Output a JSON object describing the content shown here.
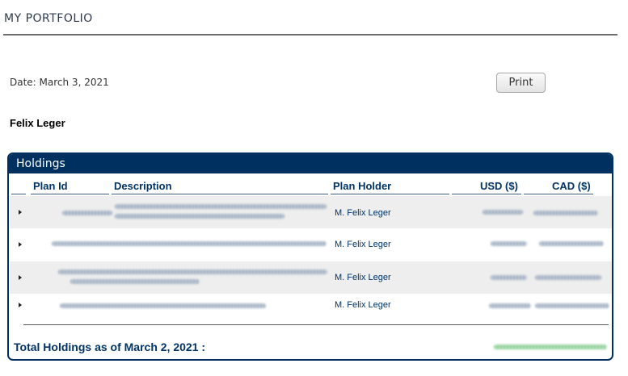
{
  "page": {
    "title": "MY PORTFOLIO"
  },
  "report": {
    "date_line": "Date: March 3, 2021",
    "print_label": "Print",
    "client_name": "Felix Leger"
  },
  "holdings": {
    "panel_title": "Holdings",
    "columns": {
      "plan_id": "Plan Id",
      "description": "Description",
      "plan_holder": "Plan Holder",
      "usd": "USD ($)",
      "cad": "CAD ($)"
    },
    "rows": [
      {
        "plan_holder": "M. Felix Leger"
      },
      {
        "plan_holder": "M. Felix Leger"
      },
      {
        "plan_holder": "M. Felix Leger"
      },
      {
        "plan_holder": "M. Felix Leger"
      }
    ],
    "total_label": "Total Holdings as of March 2, 2021 :"
  },
  "colors": {
    "brand_navy": "#00305f",
    "header_text": "#003366",
    "row_shade": "#eeeeee"
  },
  "icons": {
    "expand": "triangle-right-icon"
  }
}
